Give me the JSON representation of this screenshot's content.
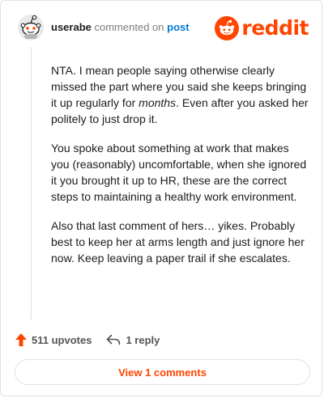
{
  "header": {
    "username": "userabe",
    "verb": "commented on",
    "post_link": "post",
    "logo_text": "reddit"
  },
  "comment": {
    "p1_before": "NTA. I mean people saying otherwise clearly missed the part where you said she keeps bringing it up regularly for ",
    "p1_em": "months",
    "p1_after": ". Even after you asked her politely to just drop it.",
    "p2": "You spoke about something at work that makes you (reasonably) uncomfortable, when she ignored it you brought it up to HR, these are the correct steps to maintaining a healthy work environment.",
    "p3": "Also that last comment of hers… yikes. Probably best to keep her at arms length and just ignore her now. Keep leaving a paper trail if she escalates."
  },
  "actions": {
    "upvotes": "511 upvotes",
    "replies": "1 reply"
  },
  "view_button": "View 1 comments",
  "colors": {
    "brand": "#ff4500",
    "link": "#0079d3",
    "text": "#1c1c1c",
    "muted": "#7c7c7c"
  },
  "icons": [
    "snoo-avatar-icon",
    "reddit-logo-icon",
    "upvote-arrow-icon",
    "reply-arrow-icon"
  ]
}
